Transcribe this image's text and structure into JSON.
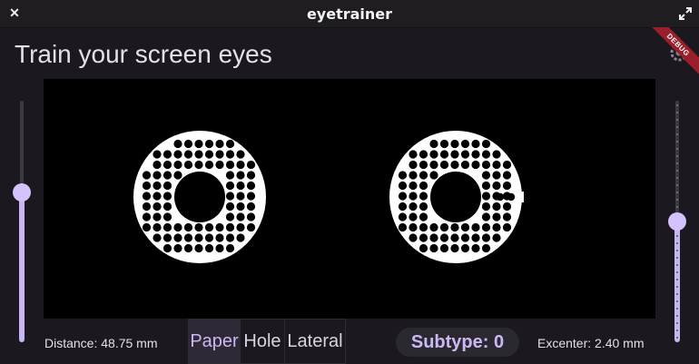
{
  "window": {
    "title": "eyetrainer"
  },
  "app": {
    "title": "Train your screen eyes",
    "debug_label": "DEBUG"
  },
  "controls": {
    "left_slider_level": 0.62,
    "right_slider_level": 0.5,
    "distance_label": "Distance: 48.75 mm",
    "excenter_label": "Excenter: 2.40 mm",
    "segments": [
      {
        "label": "Paper",
        "selected": true
      },
      {
        "label": "Hole",
        "selected": false
      },
      {
        "label": "Lateral",
        "selected": false
      }
    ],
    "subtype_label": "Subtype: 0"
  },
  "colors": {
    "accent": "#d3c2fb",
    "background": "#1b191f",
    "canvas": "#000000",
    "pattern": "#ffffff"
  }
}
